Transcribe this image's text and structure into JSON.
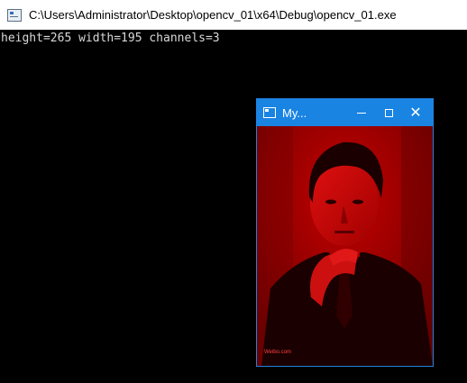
{
  "console": {
    "title": "C:\\Users\\Administrator\\Desktop\\opencv_01\\x64\\Debug\\opencv_01.exe",
    "output": "height=265 width=195 channels=3"
  },
  "image_window": {
    "title": "My...",
    "watermark": "Weibo.com",
    "close_glyph": "✕"
  },
  "colors": {
    "title_accent": "#1a84e3",
    "image_tint": "#cc0000"
  }
}
